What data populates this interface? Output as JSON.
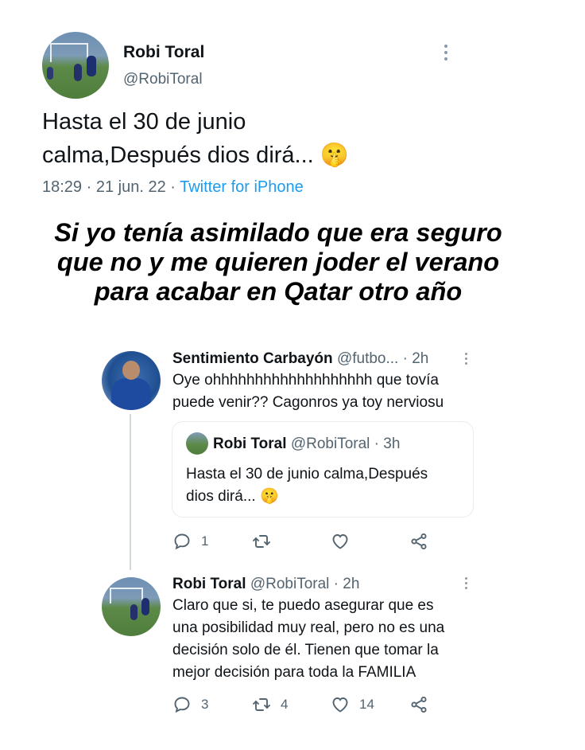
{
  "main_tweet": {
    "author_name": "Robi Toral",
    "author_handle": "@RobiToral",
    "text_line1": "Hasta el 30 de junio",
    "text_line2": "calma,Después dios dirá... ",
    "emoji": "🤫",
    "time": "18:29",
    "date": "21 jun. 22",
    "source": "Twitter for iPhone"
  },
  "caption": {
    "line1": "Si yo tenía asimilado que era seguro",
    "line2": "que no y me quieren joder el verano",
    "line3": "para acabar en Qatar otro año"
  },
  "thread_tweet": {
    "author_name": "Sentimiento Carbayón",
    "author_handle": "@futbo...",
    "age": "2h",
    "text_line1": "Oye ohhhhhhhhhhhhhhhhhhh que tovía",
    "text_line2": "puede venir?? Cagonros ya toy nerviosu",
    "quoted": {
      "author_name": "Robi Toral",
      "author_handle": "@RobiToral",
      "age": "3h",
      "text_line1": "Hasta el 30 de junio calma,Después",
      "text_line2": "dios dirá... ",
      "emoji": "🤫"
    },
    "actions": {
      "replies": "1",
      "retweets": "",
      "likes": ""
    }
  },
  "reply_tweet": {
    "author_name": "Robi Toral",
    "author_handle": "@RobiToral",
    "age": "2h",
    "text_lines": [
      "Claro que si, te puedo asegurar que es",
      "una posibilidad muy real, pero no es una",
      "decisión solo de él. Tienen que tomar la",
      "mejor decisión para toda la FAMILIA"
    ],
    "actions": {
      "replies": "3",
      "retweets": "4",
      "likes": "14"
    }
  },
  "icons": {
    "reply": "reply-icon",
    "retweet": "retweet-icon",
    "like": "heart-icon",
    "share": "share-icon",
    "more": "more-vertical-icon"
  },
  "colors": {
    "text": "#0f1419",
    "secondary": "#536471",
    "link": "#1d9bf0",
    "border": "#e6ecf0"
  }
}
